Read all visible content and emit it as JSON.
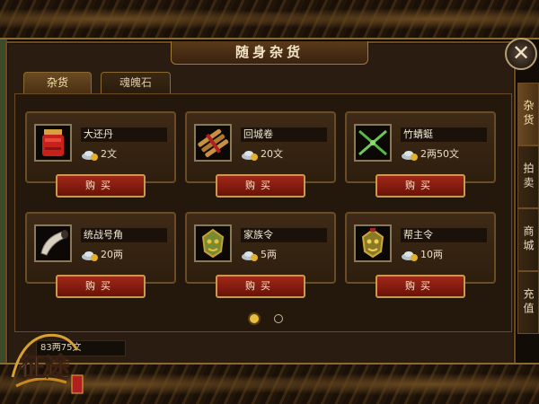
{
  "window": {
    "title": "随身杂货",
    "close_label": "✕"
  },
  "tabs": [
    {
      "label": "杂货",
      "active": true
    },
    {
      "label": "魂魄石",
      "active": false
    }
  ],
  "items": [
    {
      "name": "大还丹",
      "price": "2文",
      "icon": "red-elixir-jar-icon",
      "buy_label": "购买"
    },
    {
      "name": "回城卷",
      "price": "20文",
      "icon": "scroll-bundle-icon",
      "buy_label": "购买"
    },
    {
      "name": "竹蜻蜓",
      "price": "2两50文",
      "icon": "bamboo-dragonfly-icon",
      "buy_label": "购买"
    },
    {
      "name": "统战号角",
      "price": "20两",
      "icon": "war-horn-icon",
      "buy_label": "购买"
    },
    {
      "name": "家族令",
      "price": "5两",
      "icon": "clan-token-mask-icon",
      "buy_label": "购买"
    },
    {
      "name": "帮主令",
      "price": "10两",
      "icon": "guild-master-token-icon",
      "buy_label": "购买"
    }
  ],
  "paging": {
    "current": 1,
    "total": 2
  },
  "currency": {
    "amount": "83两75文"
  },
  "side_tabs": [
    {
      "label": "杂货",
      "active": true
    },
    {
      "label": "拍卖",
      "active": false
    },
    {
      "label": "商城",
      "active": false
    },
    {
      "label": "充值",
      "active": false
    }
  ],
  "logo": {
    "text": "征途"
  },
  "colors": {
    "buy_button": "#8a1c0e",
    "gold_border": "#c89a50",
    "panel_bg": "#24180c"
  }
}
